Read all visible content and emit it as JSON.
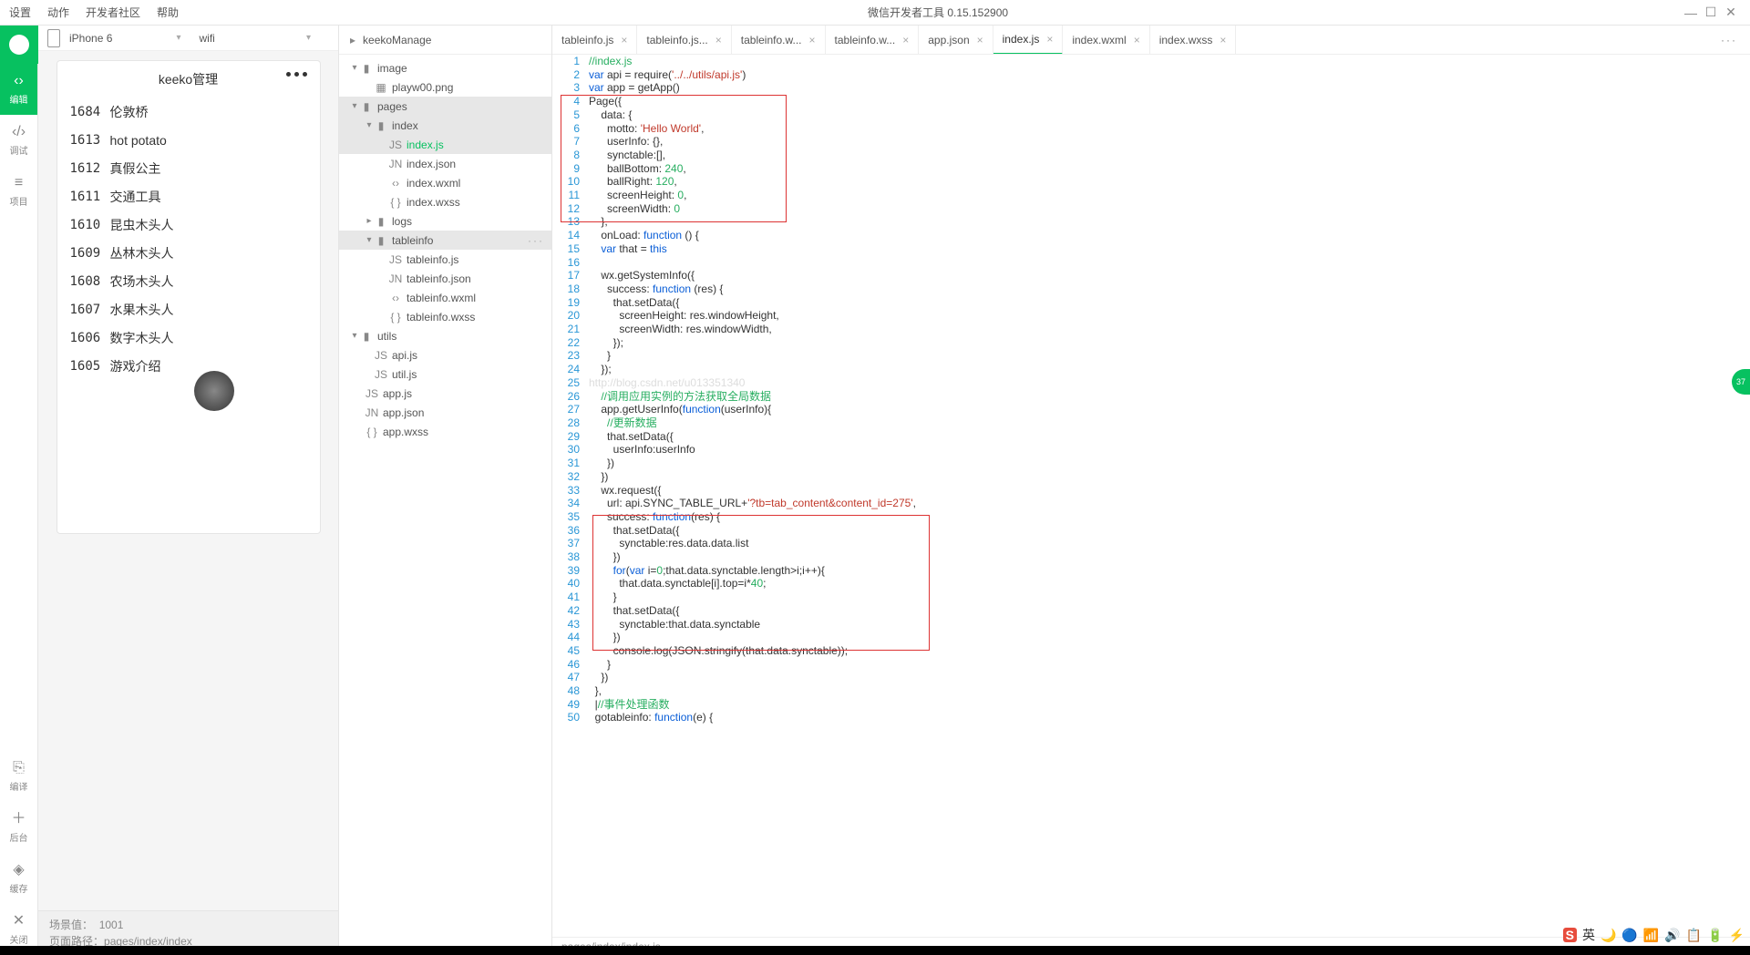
{
  "titlebar": {
    "menus": [
      "设置",
      "动作",
      "开发者社区",
      "帮助"
    ],
    "title": "微信开发者工具 0.15.152900"
  },
  "rail": {
    "items": [
      {
        "icon": "‹›",
        "label": "编辑",
        "active": true
      },
      {
        "icon": "‹/›",
        "label": "调试"
      },
      {
        "icon": "≡",
        "label": "项目"
      }
    ],
    "bottom": [
      {
        "icon": "⎘",
        "label": "编译"
      },
      {
        "icon": "＋",
        "label": "后台"
      },
      {
        "icon": "◈",
        "label": "缓存"
      },
      {
        "icon": "✕",
        "label": "关闭"
      }
    ]
  },
  "sim": {
    "device": "iPhone 6",
    "network": "wifi",
    "title": "keeko管理",
    "rows": [
      {
        "id": "1684",
        "name": "伦敦桥"
      },
      {
        "id": "1613",
        "name": "hot potato"
      },
      {
        "id": "1612",
        "name": "真假公主"
      },
      {
        "id": "1611",
        "name": "交通工具"
      },
      {
        "id": "1610",
        "name": "昆虫木头人"
      },
      {
        "id": "1609",
        "name": "丛林木头人"
      },
      {
        "id": "1608",
        "name": "农场木头人"
      },
      {
        "id": "1607",
        "name": "水果木头人"
      },
      {
        "id": "1606",
        "name": "数字木头人"
      },
      {
        "id": "1605",
        "name": "游戏介绍"
      }
    ],
    "scene_lbl": "场景值：",
    "scene": "1001",
    "path_lbl": "页面路径：",
    "path": "pages/index/index"
  },
  "tree": {
    "project": "keekoManage",
    "nodes": [
      {
        "d": 0,
        "exp": "▾",
        "t": "folder",
        "l": "image"
      },
      {
        "d": 1,
        "exp": "",
        "t": "img",
        "l": "playw00.png"
      },
      {
        "d": 0,
        "exp": "▾",
        "t": "folder",
        "l": "pages",
        "hl": true
      },
      {
        "d": 1,
        "exp": "▾",
        "t": "folder",
        "l": "index",
        "hl": true
      },
      {
        "d": 2,
        "exp": "",
        "t": "js",
        "l": "index.js",
        "sel": true
      },
      {
        "d": 2,
        "exp": "",
        "t": "json",
        "l": "index.json"
      },
      {
        "d": 2,
        "exp": "",
        "t": "wxml",
        "l": "index.wxml"
      },
      {
        "d": 2,
        "exp": "",
        "t": "wxss",
        "l": "index.wxss"
      },
      {
        "d": 1,
        "exp": "▸",
        "t": "folder",
        "l": "logs"
      },
      {
        "d": 1,
        "exp": "▾",
        "t": "folder",
        "l": "tableinfo",
        "hl": true,
        "dots": true
      },
      {
        "d": 2,
        "exp": "",
        "t": "js",
        "l": "tableinfo.js"
      },
      {
        "d": 2,
        "exp": "",
        "t": "json",
        "l": "tableinfo.json"
      },
      {
        "d": 2,
        "exp": "",
        "t": "wxml",
        "l": "tableinfo.wxml"
      },
      {
        "d": 2,
        "exp": "",
        "t": "wxss",
        "l": "tableinfo.wxss"
      },
      {
        "d": 0,
        "exp": "▾",
        "t": "folder",
        "l": "utils"
      },
      {
        "d": 1,
        "exp": "",
        "t": "js",
        "l": "api.js"
      },
      {
        "d": 1,
        "exp": "",
        "t": "js",
        "l": "util.js"
      },
      {
        "d": 0,
        "exp": "",
        "t": "js",
        "l": "app.js",
        "root": true
      },
      {
        "d": 0,
        "exp": "",
        "t": "json",
        "l": "app.json",
        "root": true
      },
      {
        "d": 0,
        "exp": "",
        "t": "wxss",
        "l": "app.wxss",
        "root": true
      }
    ]
  },
  "tabs": {
    "items": [
      {
        "l": "tableinfo.js"
      },
      {
        "l": "tableinfo.js..."
      },
      {
        "l": "tableinfo.w..."
      },
      {
        "l": "tableinfo.w..."
      },
      {
        "l": "app.json"
      },
      {
        "l": "index.js",
        "active": true
      },
      {
        "l": "index.wxml"
      },
      {
        "l": "index.wxss"
      }
    ]
  },
  "status_path": "pages/index/index.js",
  "badge": "37",
  "code_lines": [
    {
      "n": 1,
      "h": "<span class='cm'>//index.js</span>"
    },
    {
      "n": 2,
      "h": "<span class='kw'>var</span> api = require(<span class='str'>'../../utils/api.js'</span>)"
    },
    {
      "n": 3,
      "h": "<span class='kw'>var</span> app = getApp()"
    },
    {
      "n": 4,
      "h": "Page({"
    },
    {
      "n": 5,
      "h": "    data: {"
    },
    {
      "n": 6,
      "h": "      motto: <span class='str'>'Hello World'</span>,"
    },
    {
      "n": 7,
      "h": "      userInfo: {},"
    },
    {
      "n": 8,
      "h": "      synctable:[],"
    },
    {
      "n": 9,
      "h": "      ballBottom: <span class='num'>240</span>,"
    },
    {
      "n": 10,
      "h": "      ballRight: <span class='num'>120</span>,"
    },
    {
      "n": 11,
      "h": "      screenHeight: <span class='num'>0</span>,"
    },
    {
      "n": 12,
      "h": "      screenWidth: <span class='num'>0</span>"
    },
    {
      "n": 13,
      "h": "    },"
    },
    {
      "n": 14,
      "h": "    onLoad: <span class='fn'>function</span> () {"
    },
    {
      "n": 15,
      "h": "    <span class='kw'>var</span> that = <span class='kw'>this</span>"
    },
    {
      "n": 16,
      "h": ""
    },
    {
      "n": 17,
      "h": "    wx.getSystemInfo({"
    },
    {
      "n": 18,
      "h": "      success: <span class='fn'>function</span> (res) {"
    },
    {
      "n": 19,
      "h": "        that.setData({"
    },
    {
      "n": 20,
      "h": "          screenHeight: res.windowHeight,"
    },
    {
      "n": 21,
      "h": "          screenWidth: res.windowWidth,"
    },
    {
      "n": 22,
      "h": "        });"
    },
    {
      "n": 23,
      "h": "      }"
    },
    {
      "n": 24,
      "h": "    });"
    },
    {
      "n": 25,
      "h": "<span class='wm'>http://blog.csdn.net/u013351340</span>"
    },
    {
      "n": 26,
      "h": "    <span class='cm'>//调用应用实例的方法获取全局数据</span>"
    },
    {
      "n": 27,
      "h": "    app.getUserInfo(<span class='fn'>function</span>(userInfo){"
    },
    {
      "n": 28,
      "h": "      <span class='cm'>//更新数据</span>"
    },
    {
      "n": 29,
      "h": "      that.setData({"
    },
    {
      "n": 30,
      "h": "        userInfo:userInfo"
    },
    {
      "n": 31,
      "h": "      })"
    },
    {
      "n": 32,
      "h": "    })"
    },
    {
      "n": 33,
      "h": "    wx.request({"
    },
    {
      "n": 34,
      "h": "      url: api.SYNC_TABLE_URL+<span class='url'>'?tb=tab_content&content_id=275'</span>,"
    },
    {
      "n": 35,
      "h": "      success: <span class='fn'>function</span>(res) {"
    },
    {
      "n": 36,
      "h": "        that.setData({"
    },
    {
      "n": 37,
      "h": "          synctable:res.data.data.list"
    },
    {
      "n": 38,
      "h": "        })"
    },
    {
      "n": 39,
      "h": "        <span class='kw'>for</span>(<span class='kw'>var</span> i=<span class='num'>0</span>;that.data.synctable.length&gt;i;i++){"
    },
    {
      "n": 40,
      "h": "          that.data.synctable[i].top=i*<span class='num'>40</span>;"
    },
    {
      "n": 41,
      "h": "        }"
    },
    {
      "n": 42,
      "h": "        that.setData({"
    },
    {
      "n": 43,
      "h": "          synctable:that.data.synctable"
    },
    {
      "n": 44,
      "h": "        })"
    },
    {
      "n": 45,
      "h": "        console.log(JSON.stringify(that.data.synctable));"
    },
    {
      "n": 46,
      "h": "      }"
    },
    {
      "n": 47,
      "h": "    })"
    },
    {
      "n": 48,
      "h": "  },"
    },
    {
      "n": 49,
      "h": "  |<span class='cm'>//事件处理函数</span>"
    },
    {
      "n": 50,
      "h": "  gotableinfo: <span class='fn'>function</span>(e) {"
    }
  ],
  "tray": {
    "items": [
      "S",
      "英",
      "🌙",
      "🔵",
      "📶",
      "🔊",
      "📋",
      "🔋",
      "⚡"
    ]
  }
}
